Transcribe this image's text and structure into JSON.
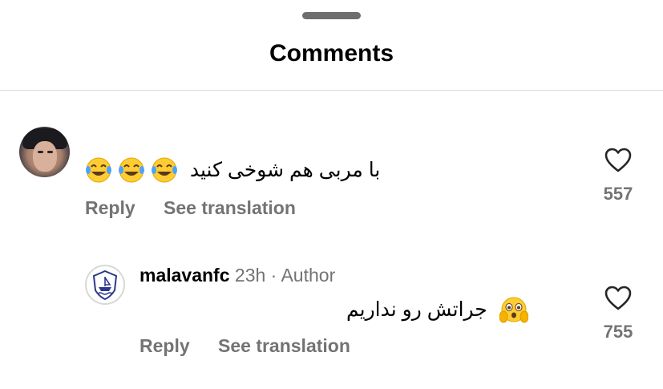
{
  "sheet": {
    "title": "Comments"
  },
  "comments": [
    {
      "text": "با مربی هم شوخی کنید",
      "emoji": [
        "face-with-tears-of-joy",
        "face-with-tears-of-joy",
        "face-with-tears-of-joy"
      ],
      "reply_label": "Reply",
      "translate_label": "See translation",
      "likes": "557"
    }
  ],
  "replies": [
    {
      "username": "malavanfc",
      "time": "23h",
      "separator": "·",
      "badge": "Author",
      "text": "جراتش رو نداریم",
      "emoji": [
        "flushed-face-with-hands"
      ],
      "reply_label": "Reply",
      "translate_label": "See translation",
      "likes": "755"
    }
  ],
  "icons": {
    "like": "heart-outline-icon",
    "accent": "#737373"
  }
}
